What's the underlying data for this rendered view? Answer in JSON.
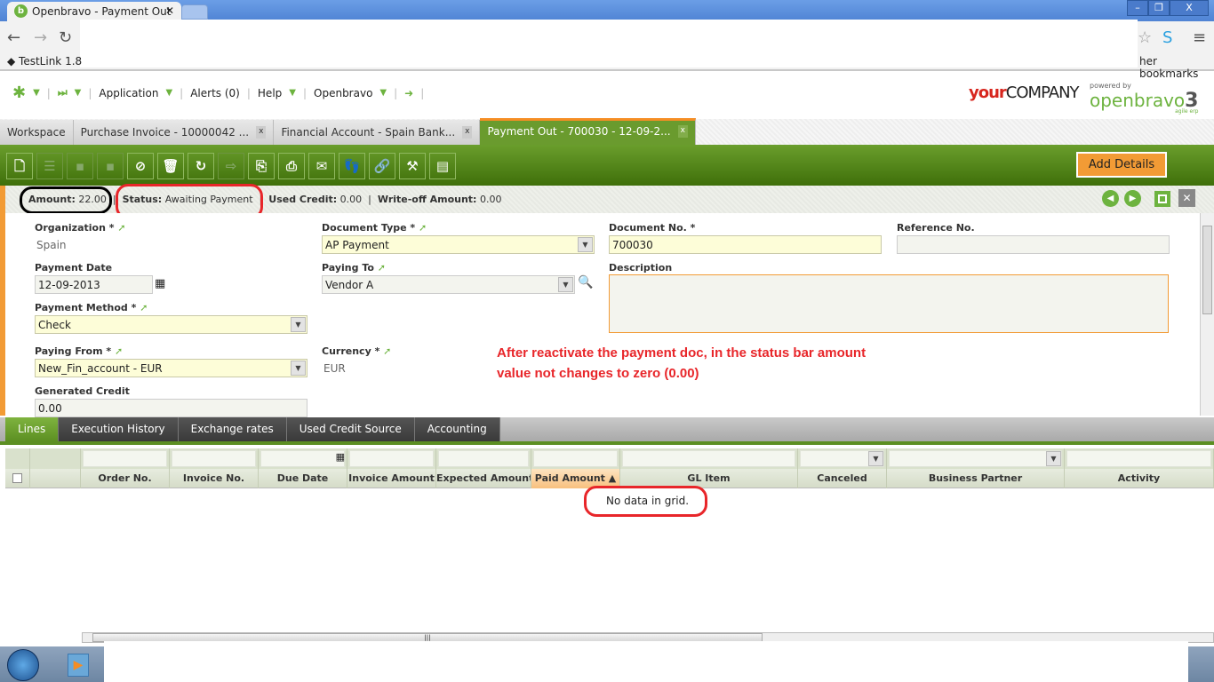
{
  "browser": {
    "tab_title": "Openbravo - Payment Out",
    "bookmark": "TestLink 1.8",
    "other_bookmarks": "her bookmarks"
  },
  "ob_nav": {
    "application": "Application",
    "alerts": "Alerts (0)",
    "help": "Help",
    "openbravo": "Openbravo"
  },
  "branding": {
    "company_bold": "your",
    "company": "COMPANY",
    "powered_by": "powered by",
    "openbravo": "openbravo",
    "version": "3",
    "tagline": "agile erp"
  },
  "window_tabs": [
    {
      "label": "Workspace"
    },
    {
      "label": "Purchase Invoice - 10000042 ..."
    },
    {
      "label": "Financial Account - Spain Bank..."
    },
    {
      "label": "Payment Out - 700030 - 12-09-2..."
    }
  ],
  "toolbar": {
    "add_details": "Add Details"
  },
  "status_bar": {
    "amount_label": "Amount:",
    "amount": "22.00",
    "status_label": "Status:",
    "status": "Awaiting Payment",
    "used_credit_label": "Used Credit:",
    "used_credit": "0.00",
    "writeoff_label": "Write-off Amount:",
    "writeoff": "0.00"
  },
  "form": {
    "organization_label": "Organization *",
    "organization": "Spain",
    "doctype_label": "Document Type *",
    "doctype": "AP Payment",
    "docno_label": "Document No. *",
    "docno": "700030",
    "refno_label": "Reference No.",
    "refno": "",
    "paydate_label": "Payment Date",
    "paydate": "12-09-2013",
    "payingto_label": "Paying To",
    "payingto": "Vendor A",
    "description_label": "Description",
    "description": "",
    "paymethod_label": "Payment Method *",
    "paymethod": "Check",
    "payingfrom_label": "Paying From *",
    "payingfrom": "New_Fin_account - EUR",
    "currency_label": "Currency *",
    "currency": "EUR",
    "gencredit_label": "Generated Credit",
    "gencredit": "0.00"
  },
  "annotation": {
    "line1": "After reactivate the payment doc, in the status bar amount",
    "line2": "value not changes to zero (0.00)"
  },
  "sub_tabs": [
    "Lines",
    "Execution History",
    "Exchange rates",
    "Used Credit Source",
    "Accounting"
  ],
  "grid": {
    "columns": [
      "Order No.",
      "Invoice No.",
      "Due Date",
      "Invoice Amount",
      "Expected Amount",
      "Paid Amount ▲",
      "GL Item",
      "Canceled",
      "Business Partner",
      "Activity"
    ],
    "empty_text": "No data in grid."
  },
  "colors": {
    "accent_green": "#5c8f22",
    "accent_orange": "#f29b35",
    "annotation_red": "#e8262a"
  }
}
